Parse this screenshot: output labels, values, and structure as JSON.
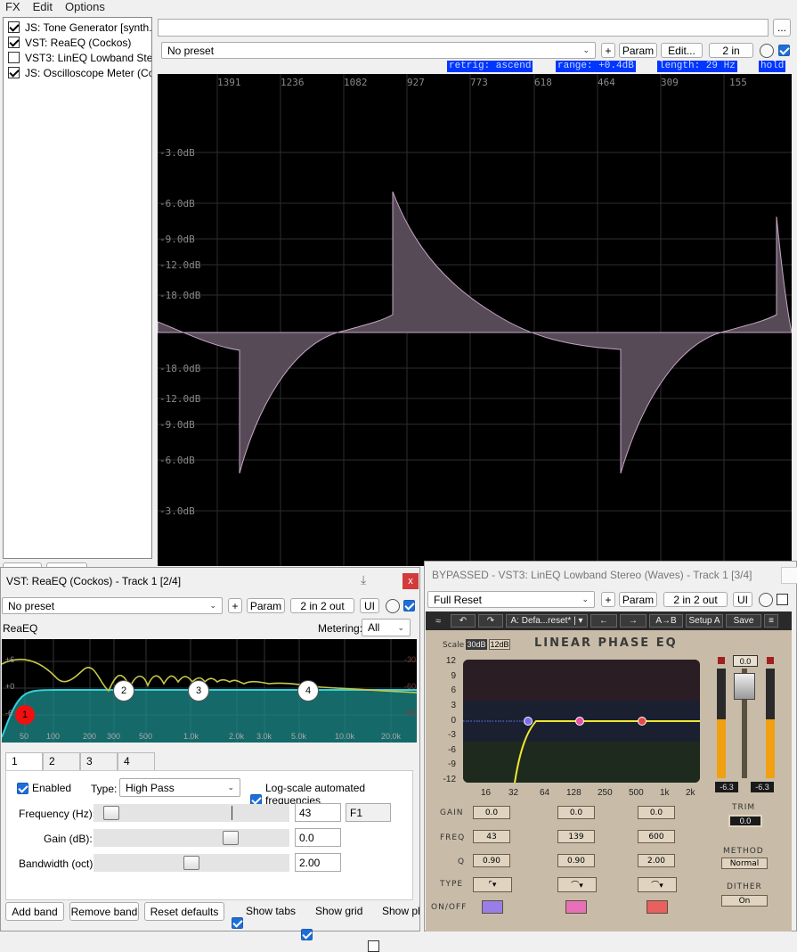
{
  "menu": {
    "fx": "FX",
    "edit": "Edit",
    "options": "Options"
  },
  "fx_list": [
    {
      "label": "JS: Tone Generator [synth...",
      "checked": true
    },
    {
      "label": "VST: ReaEQ (Cockos)",
      "checked": true
    },
    {
      "label": "VST3: LinEQ Lowband Ste...",
      "checked": false
    },
    {
      "label": "JS: Oscilloscope Meter (Co...",
      "checked": true
    }
  ],
  "top": {
    "preset": "No preset",
    "plus": "+",
    "param": "Param",
    "edit": "Edit...",
    "io": "2 in",
    "more": "..."
  },
  "scope": {
    "status": [
      "retrig: ascend",
      "range: +0.4dB",
      "length: 29 Hz",
      "hold"
    ],
    "x_ticks": [
      "1391",
      "1236",
      "1082",
      "927",
      "773",
      "618",
      "464",
      "309",
      "155"
    ],
    "y_labels": [
      "-3.0dB",
      "-6.0dB",
      "-9.0dB",
      "-12.0dB",
      "-18.0dB",
      "-18.0dB",
      "-12.0dB",
      "-9.0dB",
      "-6.0dB",
      "-3.0dB"
    ]
  },
  "reaeq": {
    "title": "VST: ReaEQ (Cockos) - Track 1 [2/4]",
    "close": "x",
    "preset": "No preset",
    "plus": "+",
    "param": "Param",
    "io": "2 in 2 out",
    "ui": "UI",
    "name": "ReaEQ",
    "metering_label": "Metering:",
    "metering_value": "All",
    "graph_left": [
      "+6",
      "+0",
      "-6"
    ],
    "graph_right": [
      "-30",
      "-60",
      "-90"
    ],
    "freq_labels": [
      "50",
      "100",
      "200",
      "300",
      "500",
      "1.0k",
      "2.0k",
      "3.0k",
      "5.0k",
      "10.0k",
      "20.0k"
    ],
    "band_nodes": [
      "1",
      "2",
      "3",
      "4"
    ],
    "tabs": [
      "1",
      "2",
      "3",
      "4"
    ],
    "enabled": "Enabled",
    "type_label": "Type:",
    "type_value": "High Pass",
    "log_scale": "Log-scale automated frequencies",
    "freq_label": "Frequency (Hz):",
    "freq_value": "43",
    "freq_note": "F1",
    "gain_label": "Gain (dB):",
    "gain_value": "0.0",
    "bw_label": "Bandwidth (oct):",
    "bw_value": "2.00",
    "buttons": {
      "add": "Add band",
      "remove": "Remove band",
      "reset": "Reset defaults"
    },
    "show_tabs": "Show tabs",
    "show_grid": "Show grid",
    "show_phase": "Show pha"
  },
  "lineq": {
    "title": "BYPASSED - VST3: LinEQ Lowband Stereo (Waves) - Track 1 [3/4]",
    "preset": "Full Reset",
    "plus": "+",
    "param": "Param",
    "io": "2 in 2 out",
    "ui": "UI",
    "toolbar": {
      "undo": "↶",
      "redo": "↷",
      "preset": "A: Defa...reset* | ▾",
      "left": "←",
      "right": "→",
      "ab": "A→B",
      "setup": "Setup A",
      "save": "Save"
    },
    "scale_label": "Scale",
    "scale_30": "30dB",
    "scale_12": "12dB",
    "brand": "LINEAR PHASE EQ",
    "y_labels": [
      "12",
      "9",
      "6",
      "3",
      "0",
      "-3",
      "-6",
      "-9",
      "-12"
    ],
    "x_labels": [
      "16",
      "32",
      "64",
      "128",
      "250",
      "500",
      "1k",
      "2k"
    ],
    "row_labels": {
      "gain": "GAIN",
      "freq": "FREQ",
      "q": "Q",
      "type": "TYPE",
      "onoff": "ON/OFF"
    },
    "bands": [
      {
        "gain": "0.0",
        "freq": "43",
        "q": "0.90"
      },
      {
        "gain": "0.0",
        "freq": "139",
        "q": "0.90"
      },
      {
        "gain": "0.0",
        "freq": "600",
        "q": "2.00"
      }
    ],
    "onoff_colors": [
      "#9a7ee8",
      "#e870b8",
      "#e86060"
    ],
    "meter_top": "0.0",
    "meter_l": "-6.3",
    "meter_r": "-6.3",
    "trim_label": "TRIM",
    "trim_value": "0.0",
    "method_label": "METHOD",
    "method_value": "Normal",
    "dither_label": "DITHER",
    "dither_value": "On"
  }
}
